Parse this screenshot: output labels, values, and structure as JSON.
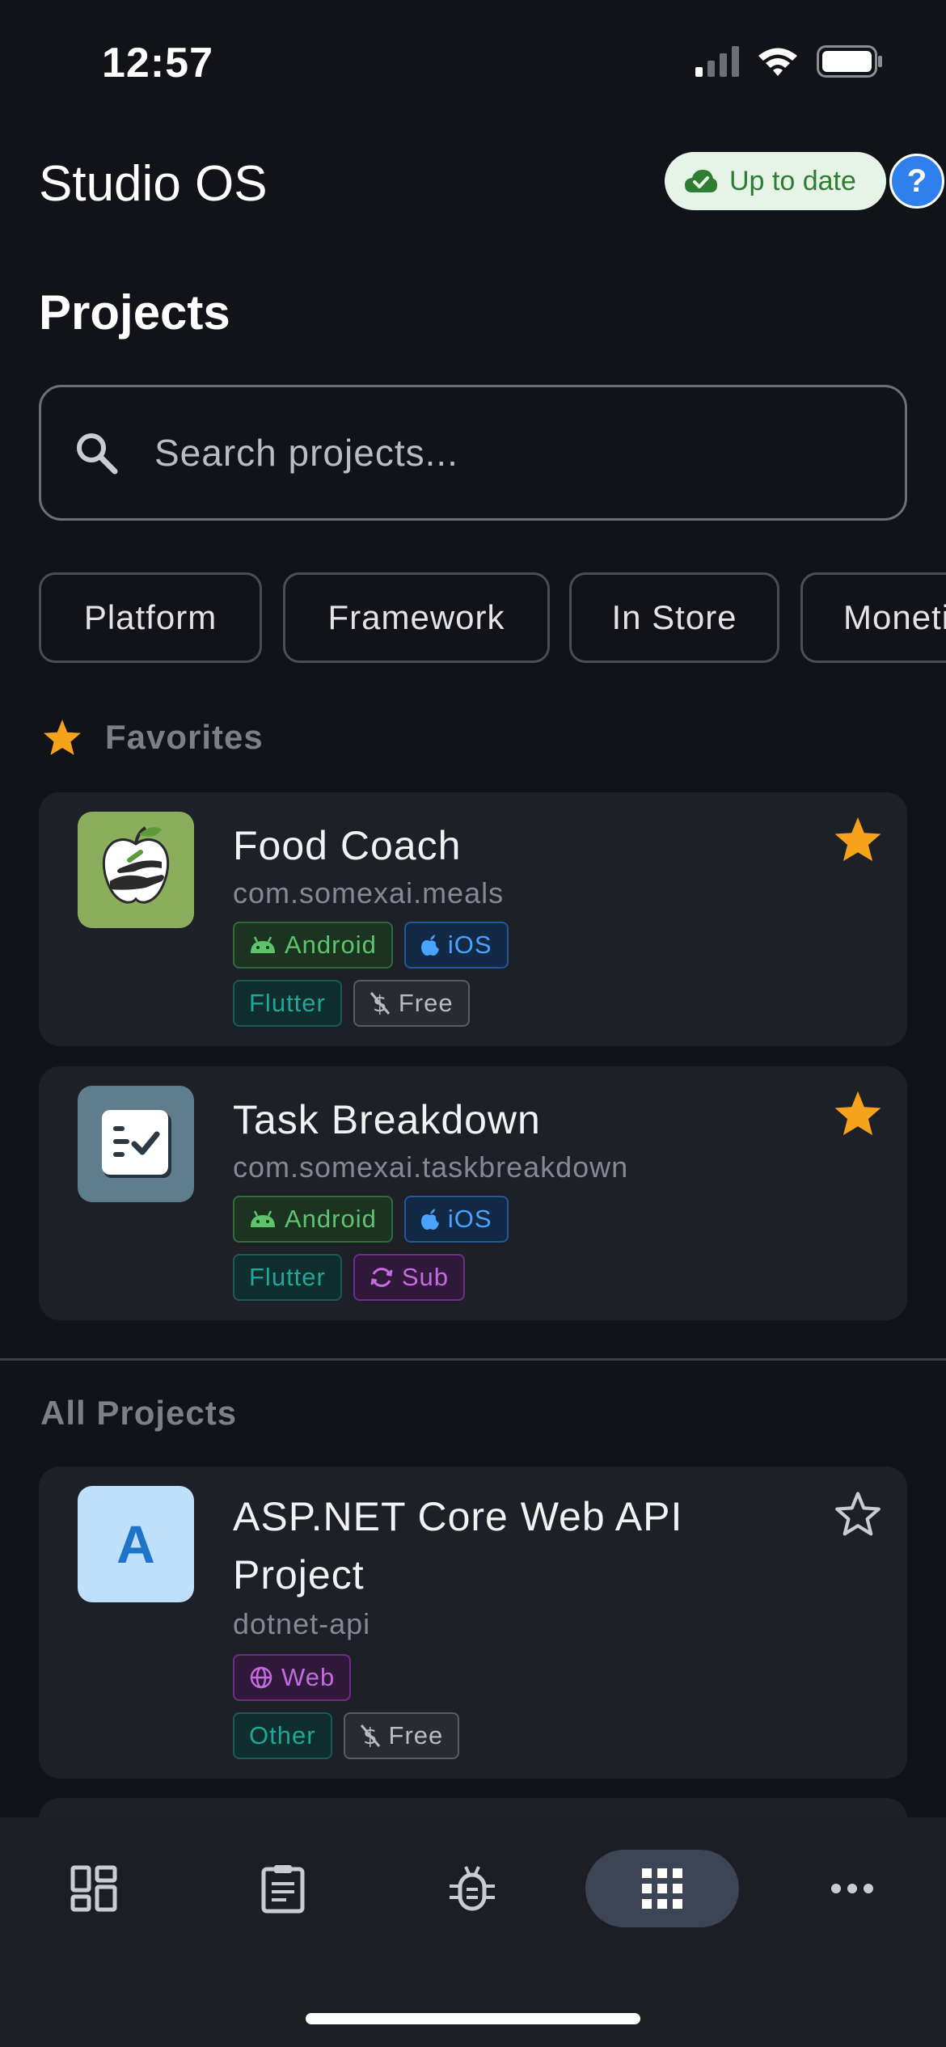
{
  "status_bar": {
    "time": "12:57"
  },
  "header": {
    "app_title": "Studio OS",
    "sync_status": "Up to date",
    "help_label": "?"
  },
  "page": {
    "title": "Projects"
  },
  "search": {
    "placeholder": "Search projects...",
    "value": ""
  },
  "filters": [
    "Platform",
    "Framework",
    "In Store",
    "Monetization"
  ],
  "favorites": {
    "header": "Favorites",
    "projects": [
      {
        "name": "Food Coach",
        "package": "com.somexai.meals",
        "platforms": [
          "Android",
          "iOS"
        ],
        "framework": "Flutter",
        "monetization": "Free",
        "favorite": true
      },
      {
        "name": "Task Breakdown",
        "package": "com.somexai.taskbreakdown",
        "platforms": [
          "Android",
          "iOS"
        ],
        "framework": "Flutter",
        "monetization": "Sub",
        "favorite": true
      }
    ]
  },
  "all_projects": {
    "header": "All Projects",
    "projects": [
      {
        "name_line1": "ASP.NET Core Web API",
        "name_line2": "Project",
        "initial": "A",
        "package": "dotnet-api",
        "platforms": [
          "Web"
        ],
        "framework": "Other",
        "monetization": "Free",
        "favorite": false
      }
    ]
  },
  "bottom_nav": {
    "items": [
      "dashboard-icon",
      "clipboard-icon",
      "bug-icon",
      "apps-grid-icon",
      "more-icon"
    ],
    "active": "apps-grid-icon"
  },
  "colors": {
    "background": "#111318",
    "card": "#1e2027",
    "star": "#f7a21b",
    "accent_blue": "#2f80ed"
  }
}
